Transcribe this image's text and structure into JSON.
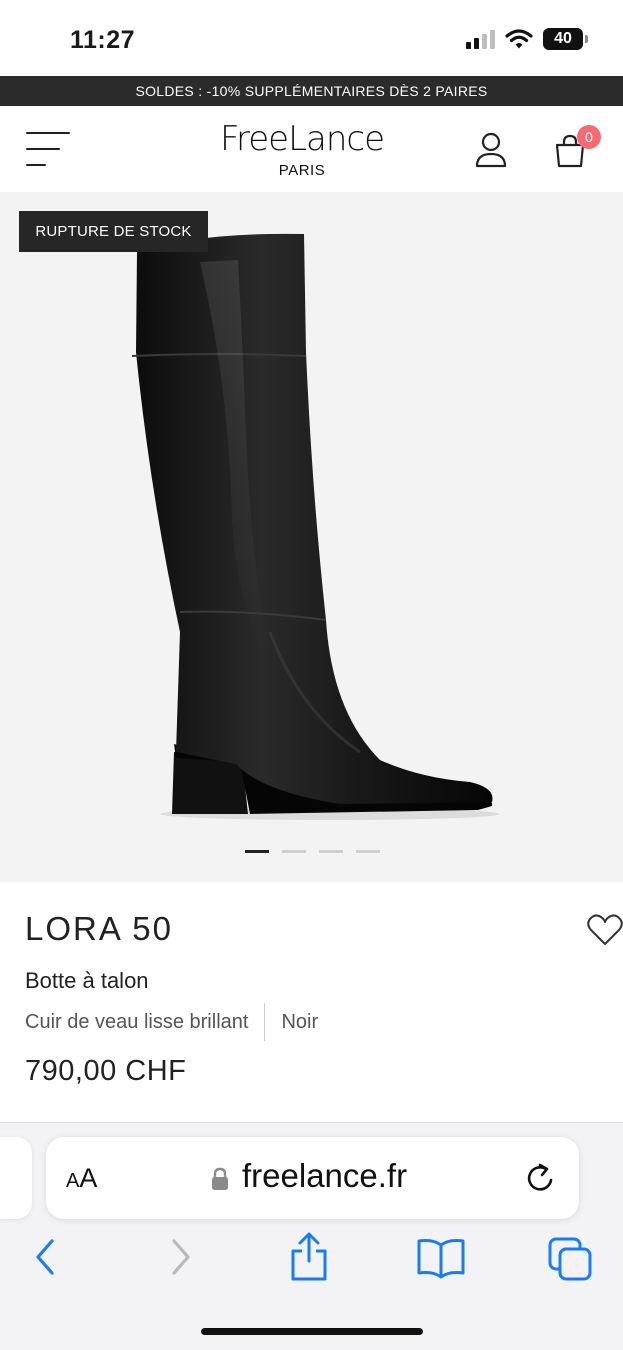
{
  "status_bar": {
    "time": "11:27",
    "battery": "40"
  },
  "promo": {
    "text": "SOLDES : -10% SUPPLÉMENTAIRES DÈS 2 PAIRES"
  },
  "header": {
    "logo_main": "FreeLance",
    "logo_sub": "PARIS",
    "cart_count": "0"
  },
  "gallery": {
    "stock_badge": "RUPTURE DE STOCK",
    "slides_total": 4,
    "active_slide": 1
  },
  "product": {
    "name": "LORA 50",
    "type": "Botte à talon",
    "material": "Cuir de veau lisse brillant",
    "color": "Noir",
    "price": "790,00 CHF"
  },
  "browser": {
    "aa_small": "A",
    "aa_large": "A",
    "url": "freelance.fr"
  },
  "icons": {
    "menu": "hamburger-icon",
    "account": "user-icon",
    "cart": "shopping-bag-icon",
    "wishlist": "heart-icon",
    "lock": "lock-icon",
    "reload": "reload-icon",
    "back": "chevron-left-icon",
    "forward": "chevron-right-icon",
    "share": "share-icon",
    "bookmarks": "book-icon",
    "tabs": "tabs-icon"
  },
  "colors": {
    "promo_bg": "#2b2b2b",
    "badge_bg": "#262626",
    "cart_badge": "#f46b73",
    "safari_blue": "#1a7cf5"
  }
}
